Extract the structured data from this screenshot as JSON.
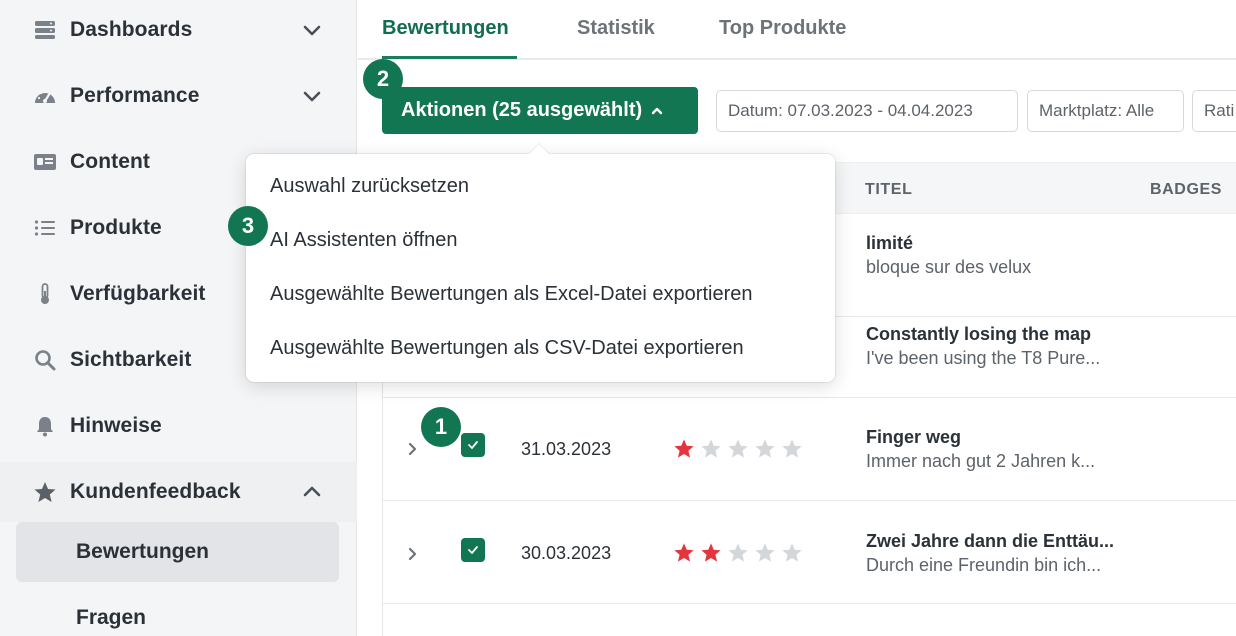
{
  "sidebar": {
    "items": [
      {
        "label": "Dashboards",
        "icon": "server-icon"
      },
      {
        "label": "Performance",
        "icon": "speedometer-icon"
      },
      {
        "label": "Content",
        "icon": "id-card-icon"
      },
      {
        "label": "Produkte",
        "icon": "list-icon"
      },
      {
        "label": "Verfügbarkeit",
        "icon": "thermometer-icon"
      },
      {
        "label": "Sichtbarkeit",
        "icon": "search-icon"
      },
      {
        "label": "Hinweise",
        "icon": "bell-icon"
      },
      {
        "label": "Kundenfeedback",
        "icon": "star-icon"
      }
    ],
    "sub_items": [
      {
        "label": "Bewertungen",
        "active": true
      },
      {
        "label": "Fragen",
        "active": false
      }
    ]
  },
  "tabs": [
    {
      "label": "Bewertungen",
      "active": true
    },
    {
      "label": "Statistik",
      "active": false
    },
    {
      "label": "Top Produkte",
      "active": false
    }
  ],
  "toolbar": {
    "actions_label": "Aktionen (25 ausgewählt)",
    "filters": [
      "Datum: 07.03.2023 - 04.04.2023",
      "Marktplatz: Alle",
      "Rati"
    ]
  },
  "table": {
    "columns": {
      "title": "TITEL",
      "badges": "BADGES"
    },
    "rows": [
      {
        "title": "limité",
        "snippet": "bloque sur des velux"
      },
      {
        "title": "Constantly losing the map",
        "snippet": "I've been using the T8 Pure..."
      },
      {
        "date": "31.03.2023",
        "rating": 1,
        "title": "Finger weg",
        "snippet": "Immer nach gut 2 Jahren k...",
        "checked": true
      },
      {
        "date": "30.03.2023",
        "rating": 2,
        "title": "Zwei Jahre dann die Enttäu...",
        "snippet": "Durch eine Freundin bin ich...",
        "checked": true
      }
    ]
  },
  "dropdown": {
    "items": [
      "Auswahl zurücksetzen",
      "AI Assistenten öffnen",
      "Ausgewählte Bewertungen als Excel-Datei exportieren",
      "Ausgewählte Bewertungen als CSV-Datei exportieren"
    ]
  },
  "steps": [
    "1",
    "2",
    "3"
  ],
  "colors": {
    "accent": "#127652",
    "star_filled": "#e5353c",
    "star_empty": "#d4d7da"
  }
}
